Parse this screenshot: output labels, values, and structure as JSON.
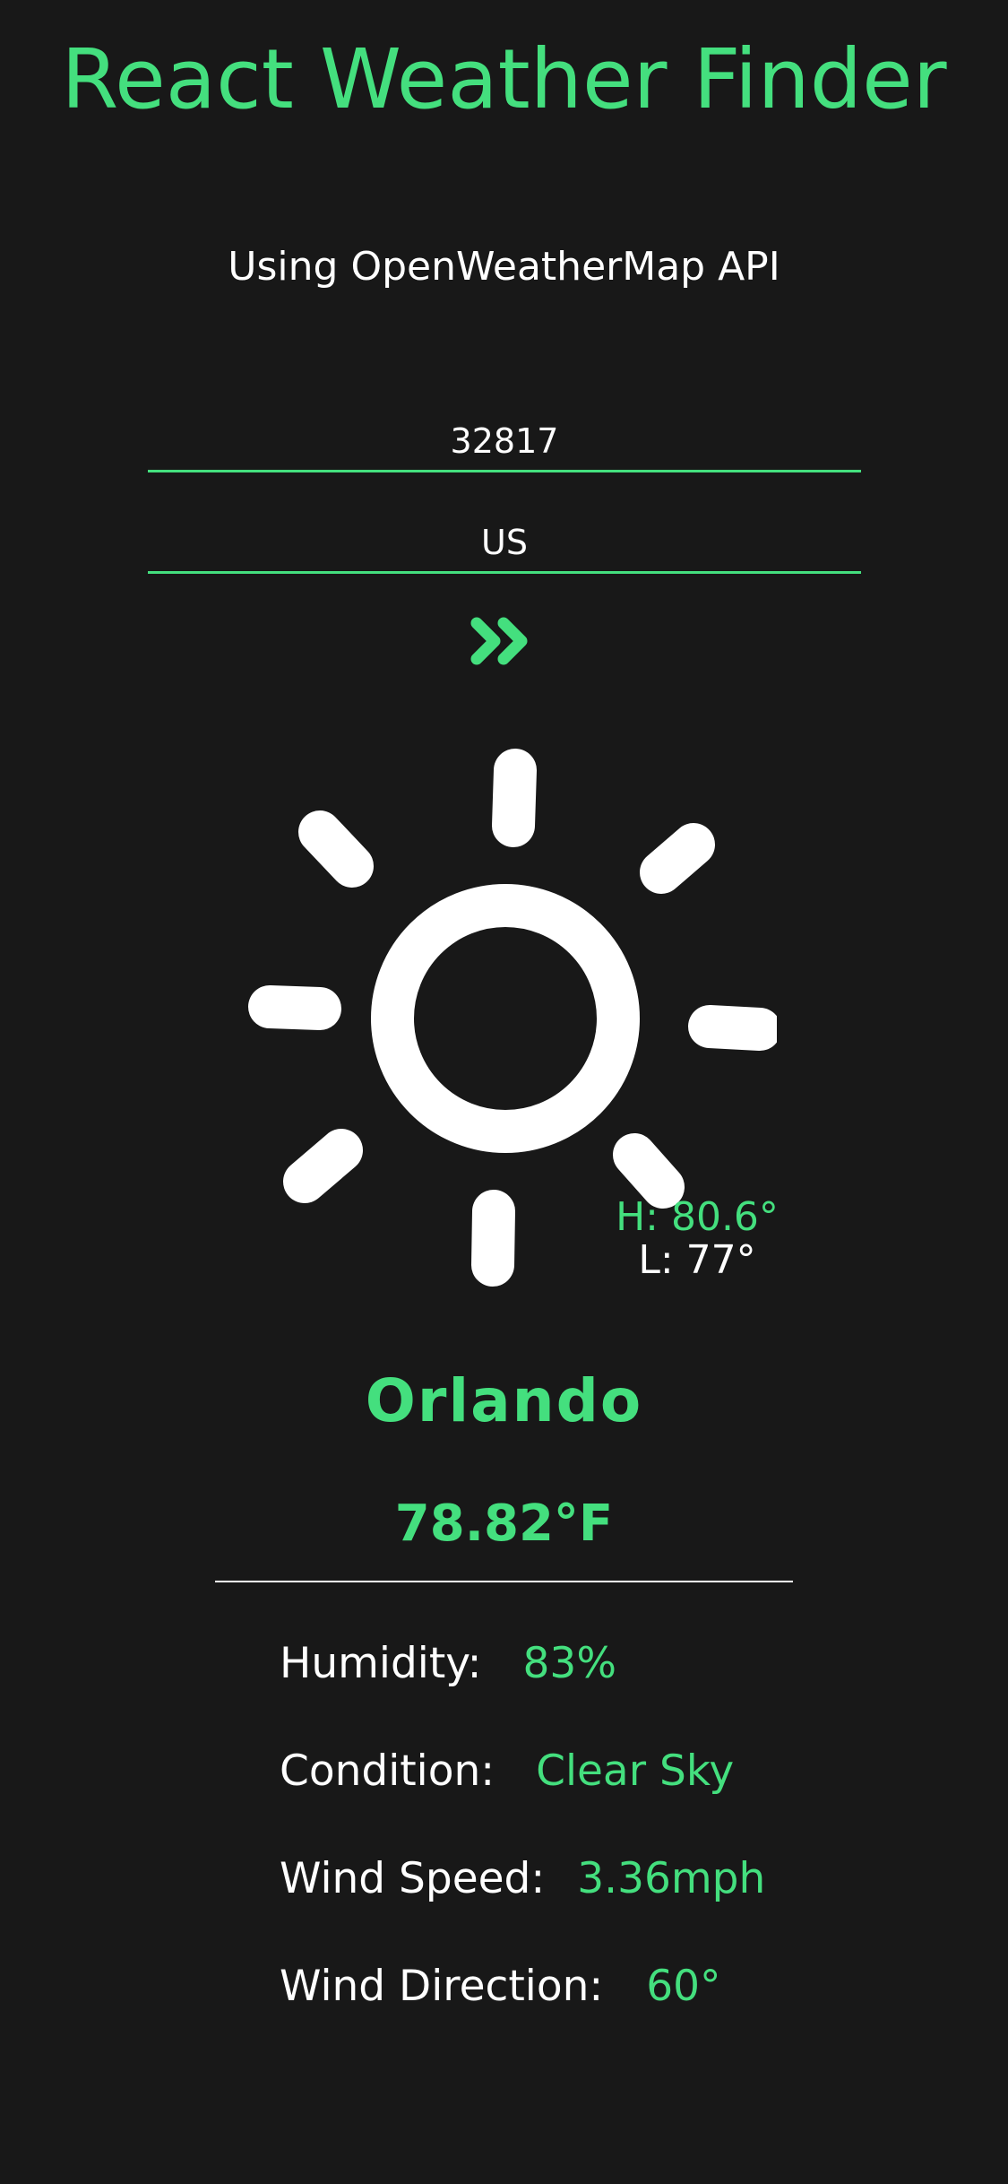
{
  "header": {
    "title": "React Weather Finder",
    "subtitle": "Using OpenWeatherMap API"
  },
  "form": {
    "zip_value": "32817",
    "country_value": "US",
    "submit_icon": "double-chevron-right-icon"
  },
  "weather": {
    "icon": "sun-icon",
    "high": "H: 80.6°",
    "low": "L: 77°",
    "city": "Orlando",
    "temperature": "78.82°F",
    "details": [
      {
        "label": "Humidity:",
        "value": "83%"
      },
      {
        "label": "Condition:",
        "value": "Clear Sky"
      },
      {
        "label": "Wind Speed:",
        "value": "3.36mph"
      },
      {
        "label": "Wind Direction:",
        "value": "60°"
      }
    ]
  },
  "colors": {
    "accent": "#44df7e",
    "background": "#181818",
    "text": "#ffffff"
  }
}
